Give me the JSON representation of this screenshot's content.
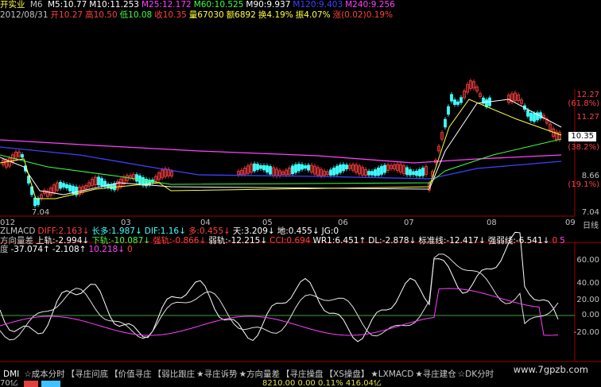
{
  "header": {
    "title": "开实业",
    "period": "M6",
    "ma_line": [
      {
        "text": "M5:10.77",
        "color": "#ffffff"
      },
      {
        "text": "M10:11.253",
        "color": "#ffffff"
      },
      {
        "text": "M25:12.172",
        "color": "#ff40ff"
      },
      {
        "text": "M60:10.525",
        "color": "#40ff40"
      },
      {
        "text": "M90:9.937",
        "color": "#ffffff"
      },
      {
        "text": "M120:9.403",
        "color": "#4040ff"
      },
      {
        "text": "M240:9.256",
        "color": "#ff40ff"
      }
    ],
    "ohlc_line": [
      {
        "text": "2012/08/31",
        "color": "#c0c0c0"
      },
      {
        "text": "开10.27",
        "color": "#ff4040"
      },
      {
        "text": "高10.50",
        "color": "#ff4040"
      },
      {
        "text": "低10.08",
        "color": "#40ff40"
      },
      {
        "text": "收10.35",
        "color": "#ff4040"
      },
      {
        "text": "量67030",
        "color": "#ffff40"
      },
      {
        "text": "额6892",
        "color": "#ffff40"
      },
      {
        "text": "换4.19%",
        "color": "#ffff40"
      },
      {
        "text": "振4.07%",
        "color": "#ffff40"
      },
      {
        "text": "涨(0.02)0.19%",
        "color": "#ff4040"
      }
    ]
  },
  "price_axis": {
    "labels": [
      {
        "text": "12.27",
        "color": "#ff4040"
      },
      {
        "text": "(61.8%)",
        "color": "#ff4040"
      },
      {
        "text": "11.27",
        "color": "#ff4040"
      },
      {
        "text": "10.35",
        "color": "#ffffff"
      },
      {
        "text": "(38.2%)",
        "color": "#ff4040"
      },
      {
        "text": "8.66",
        "color": "#c0c0c0"
      },
      {
        "text": "(19.1%)",
        "color": "#ff4040"
      },
      {
        "text": "7.04",
        "color": "#c0c0c0"
      }
    ],
    "low_marker": "7.04"
  },
  "x_axis": {
    "labels": [
      "012",
      "03",
      "04",
      "05",
      "06",
      "07",
      "08",
      "09"
    ],
    "unit": "日线"
  },
  "indicator1": {
    "line1": [
      {
        "text": "ZLMACD",
        "color": "#c0c0c0"
      },
      {
        "text": "DIFF:2.163↓",
        "color": "#ff4040"
      },
      {
        "text": "长多:1.987↓",
        "color": "#40ffff"
      },
      {
        "text": "DIF:1.16↓",
        "color": "#40ffff"
      },
      {
        "text": "多:0.455↓",
        "color": "#ff4040"
      },
      {
        "text": "天:3.209↓",
        "color": "#ffffff"
      },
      {
        "text": "地:0.455↓",
        "color": "#ffffff"
      },
      {
        "text": "JG:0",
        "color": "#ffffff"
      }
    ],
    "line2": [
      {
        "text": "方向量差",
        "color": "#c0c0c0"
      },
      {
        "text": "上轨:-2.994↓",
        "color": "#ffffff"
      },
      {
        "text": "下轨:-10.087↓",
        "color": "#40ff40"
      },
      {
        "text": "强轨:-0.866↓",
        "color": "#ff4040"
      },
      {
        "text": "弱轨:-12.215↓",
        "color": "#ffffff"
      },
      {
        "text": "CCI:0.694",
        "color": "#ff4040"
      },
      {
        "text": "WR1:6.451↑",
        "color": "#ffffff"
      },
      {
        "text": "DL:-2.878↓",
        "color": "#ffffff"
      },
      {
        "text": "标准线:-12.417↓",
        "color": "#ffffff"
      },
      {
        "text": "强弱线:-6.541↓",
        "color": "#ffffff"
      },
      {
        "text": "0",
        "color": "#ff4040"
      },
      {
        "text": "5",
        "color": "#ff40ff"
      }
    ],
    "line3": [
      {
        "text": "度",
        "color": "#c0c0c0"
      },
      {
        "text": "-37.074↑",
        "color": "#ffffff"
      },
      {
        "text": "-2.108↑",
        "color": "#ffffff"
      },
      {
        "text": "10.218↓",
        "color": "#ff40ff"
      },
      {
        "text": "0",
        "color": "#ff4040"
      }
    ]
  },
  "indicator2_axis": [
    "60.00",
    "40.00",
    "20.00",
    "0.00",
    "-20.00"
  ],
  "tabs": [
    "DMI",
    "☆成本分时",
    "【寻庄问底",
    "【价值寻庄",
    "【弱比跟庄",
    "★寻庄诉势",
    "★方向量差",
    "【寻庄操盘",
    "【XS操盘】",
    "★LXMACD",
    "★寻庄建仓",
    "☆DK分时"
  ],
  "status": {
    "text": "70亿",
    "mid_text": "8210.00  0.00  0.11%  416.04亿"
  },
  "watermark": "www.7gpzb.com"
}
